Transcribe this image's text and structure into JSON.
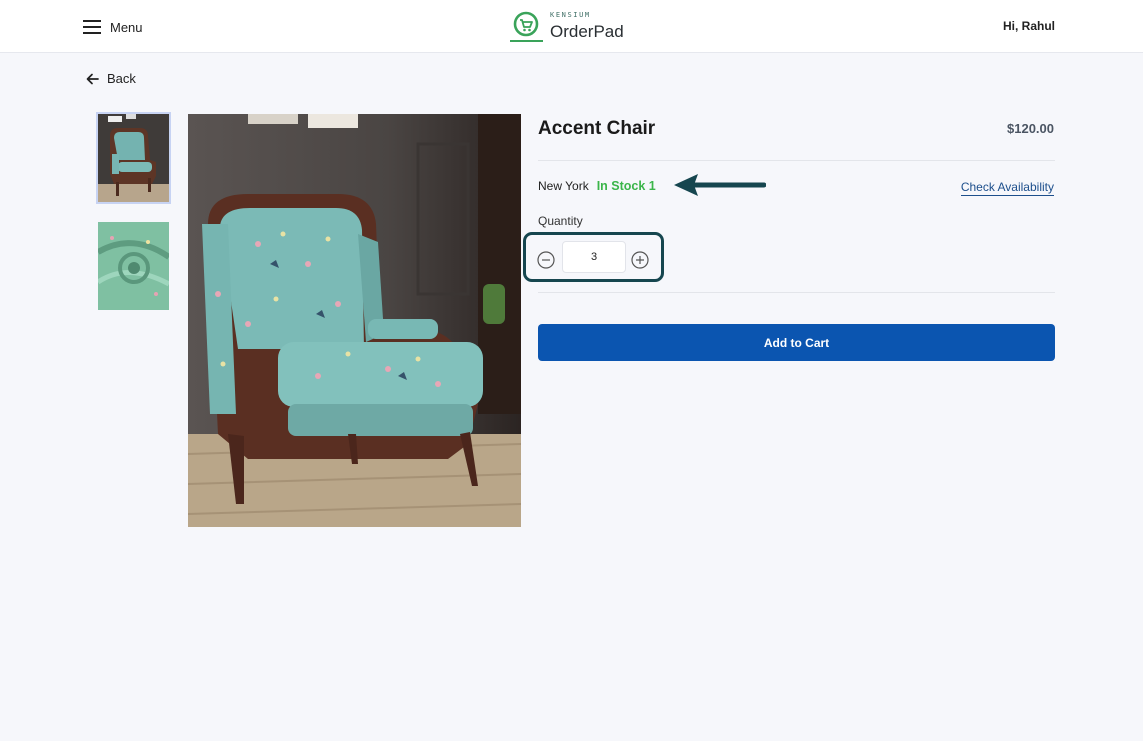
{
  "header": {
    "menu_label": "Menu",
    "brand_small": "KENSIUM",
    "brand_name": "OrderPad",
    "greeting": "Hi, Rahul"
  },
  "nav": {
    "back_label": "Back"
  },
  "product": {
    "title": "Accent Chair",
    "price": "$120.00",
    "location": "New York",
    "stock_status": "In Stock 1",
    "check_availability_label": "Check Availability",
    "quantity_label": "Quantity",
    "quantity_value": "3",
    "add_to_cart_label": "Add to Cart"
  },
  "colors": {
    "accent_button": "#0b55b0",
    "in_stock": "#3bb54a",
    "annotation": "#16464f",
    "link": "#1d4f8c"
  }
}
